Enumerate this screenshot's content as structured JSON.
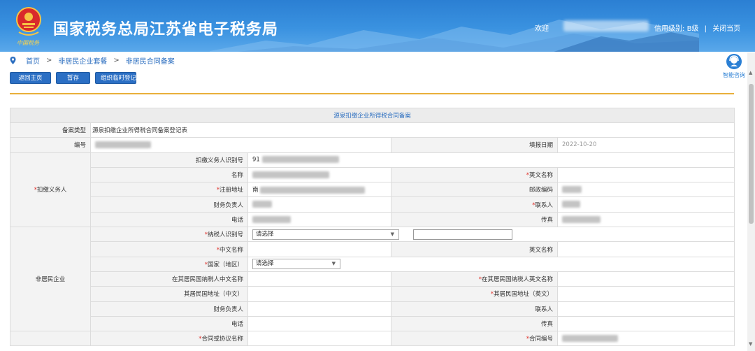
{
  "header": {
    "site_title": "国家税务总局江苏省电子税务局",
    "brand_sub": "中国税务",
    "welcome": "欢迎",
    "credit_label": "信用级别:",
    "credit_value": "B级",
    "separator": "|",
    "close_page": "关闭当页"
  },
  "breadcrumb": {
    "items": [
      "首页",
      "非居民企业套餐",
      "非居民合同备案"
    ],
    "separator": ">"
  },
  "helper": {
    "label": "智能咨询"
  },
  "toolbar": {
    "back_home": "返回主页",
    "save_draft": "暂存",
    "org_register": "组织临时登记"
  },
  "form": {
    "title": "源泉扣缴企业所得税合同备案",
    "record_type_label": "备案类型",
    "record_type_value": "源泉扣缴企业所得税合同备案登记表",
    "number_label": "编号",
    "fill_date_label": "填报日期",
    "fill_date_value": "2022-10-20",
    "withholder": {
      "section": "扣缴义务人",
      "taxpayer_id_label": "扣缴义务人识别号",
      "taxpayer_id_prefix": "91",
      "name_label": "名称",
      "english_name_label": "英文名称",
      "reg_address_label": "注册地址",
      "reg_address_prefix": "南",
      "postcode_label": "邮政编码",
      "finance_head_label": "财务负责人",
      "contact_label": "联系人",
      "phone_label": "电话",
      "fax_label": "传真"
    },
    "nonresident": {
      "section": "非居民企业",
      "taxpayer_id_label": "纳税人识别号",
      "taxpayer_id_placeholder": "请选择",
      "chinese_name_label": "中文名称",
      "english_name_label": "英文名称",
      "country_label": "国家（地区）",
      "country_placeholder": "请选择",
      "home_cn_name_label": "在其居民国纳税人中文名称",
      "home_en_name_label": "在其居民国纳税人英文名称",
      "home_cn_address_label": "其居民国地址（中文）",
      "home_en_address_label": "其居民国地址（英文）",
      "finance_head_label": "财务负责人",
      "contact_label": "联系人",
      "phone_label": "电话",
      "fax_label": "传真"
    },
    "contract": {
      "name_label": "合同或协议名称",
      "number_label": "合同编号"
    }
  },
  "colors": {
    "header_blue": "#2b7fd3",
    "button_blue": "#2b6fc4",
    "divider_gold": "#e9b03b",
    "required_red": "#e0302a",
    "link_blue": "#2d6fc0"
  }
}
